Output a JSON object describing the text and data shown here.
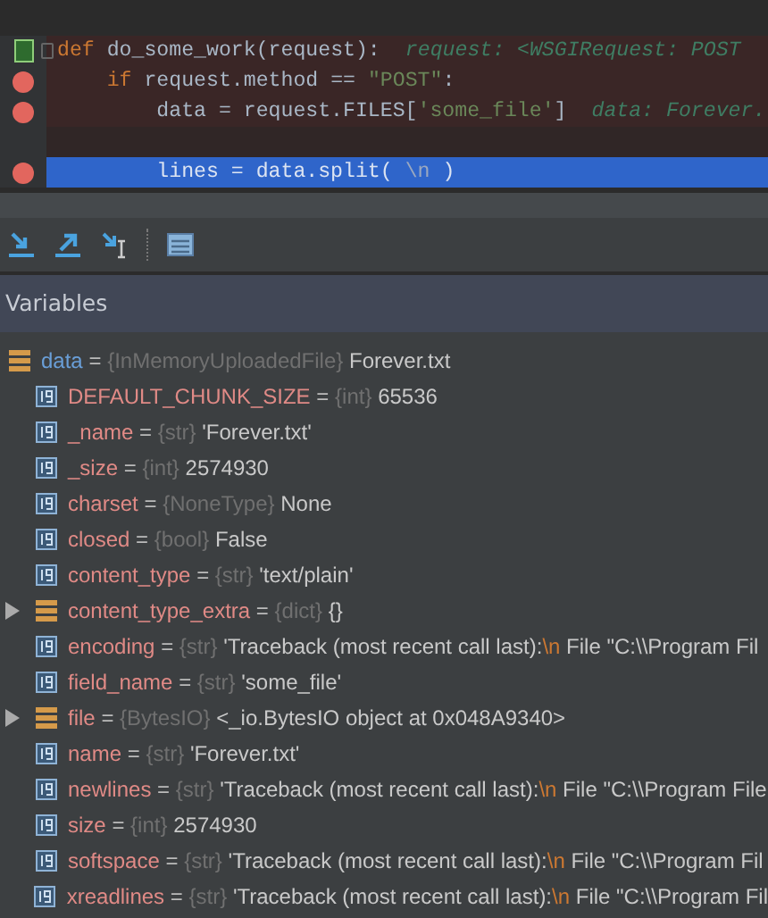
{
  "editor": {
    "lines": [
      {
        "breakpoint": false,
        "selected": false,
        "marker": true,
        "fold": true,
        "tokens": [
          {
            "kind": "keyword",
            "text": "def"
          },
          {
            "kind": "plain",
            "text": " do_some_work(request):"
          },
          {
            "kind": "hint",
            "text": "request: <WSGIRequest: POST"
          }
        ]
      },
      {
        "breakpoint": true,
        "selected": false,
        "marker": false,
        "fold": false,
        "tokens": [
          {
            "kind": "keyword",
            "text": "    if"
          },
          {
            "kind": "plain",
            "text": " request.method == "
          },
          {
            "kind": "string",
            "text": "\"POST\""
          },
          {
            "kind": "plain",
            "text": ":"
          }
        ]
      },
      {
        "breakpoint": true,
        "selected": false,
        "marker": false,
        "fold": false,
        "tokens": [
          {
            "kind": "plain",
            "text": "        data = request.FILES["
          },
          {
            "kind": "string",
            "text": "'some_file'"
          },
          {
            "kind": "plain",
            "text": "]"
          },
          {
            "kind": "hint",
            "text": "data: Forever."
          }
        ]
      },
      {
        "breakpoint": false,
        "selected": false,
        "marker": false,
        "fold": false
      },
      {
        "breakpoint": true,
        "selected": true,
        "marker": false,
        "fold": false,
        "tokens": [
          {
            "kind": "plain",
            "text": "        lines = data.split( "
          },
          {
            "kind": "string",
            "text": "\\n"
          },
          {
            "kind": "plain",
            "text": " )"
          }
        ]
      }
    ]
  },
  "toolbar": [
    {
      "kind": "step-into"
    },
    {
      "kind": "step-out"
    },
    {
      "kind": "step-into-my-code"
    },
    {
      "kind": "separator"
    },
    {
      "kind": "evaluate"
    }
  ],
  "panel_title": "Variables",
  "variables": [
    {
      "kind": "object",
      "expandable": false,
      "name": "data",
      "op": "=",
      "type": "{InMemoryUploadedFile}",
      "value": [
        {
          "kind": "plain",
          "text": "Forever.txt"
        }
      ],
      "children": [
        {
          "kind": "field",
          "expandable": false,
          "name": "DEFAULT_CHUNK_SIZE",
          "op": "=",
          "type": "{int}",
          "value": [
            {
              "kind": "plain",
              "text": "65536"
            }
          ]
        },
        {
          "kind": "field",
          "expandable": false,
          "name": "_name",
          "op": "=",
          "type": "{str}",
          "value": [
            {
              "kind": "plain",
              "text": "'Forever.txt'"
            }
          ]
        },
        {
          "kind": "field",
          "expandable": false,
          "name": "_size",
          "op": "=",
          "type": "{int}",
          "value": [
            {
              "kind": "plain",
              "text": "2574930"
            }
          ]
        },
        {
          "kind": "field",
          "expandable": false,
          "name": "charset",
          "op": "=",
          "type": "{NoneType}",
          "value": [
            {
              "kind": "plain",
              "text": "None"
            }
          ]
        },
        {
          "kind": "field",
          "expandable": false,
          "name": "closed",
          "op": "=",
          "type": "{bool}",
          "value": [
            {
              "kind": "plain",
              "text": "False"
            }
          ]
        },
        {
          "kind": "field",
          "expandable": false,
          "name": "content_type",
          "op": "=",
          "type": "{str}",
          "value": [
            {
              "kind": "plain",
              "text": "'text/plain'"
            }
          ]
        },
        {
          "kind": "object",
          "expandable": true,
          "name": "content_type_extra",
          "op": "=",
          "type": "{dict}",
          "value": [
            {
              "kind": "plain",
              "text": "{}"
            }
          ]
        },
        {
          "kind": "field",
          "expandable": false,
          "name": "encoding",
          "op": "=",
          "type": "{str}",
          "value": [
            {
              "kind": "plain",
              "text": "'Traceback (most recent call last):"
            },
            {
              "kind": "escape",
              "text": "\\n"
            },
            {
              "kind": "plain",
              "text": "  File \"C:\\\\Program Fil"
            }
          ]
        },
        {
          "kind": "field",
          "expandable": false,
          "name": "field_name",
          "op": "=",
          "type": "{str}",
          "value": [
            {
              "kind": "plain",
              "text": "'some_file'"
            }
          ]
        },
        {
          "kind": "object",
          "expandable": true,
          "name": "file",
          "op": "=",
          "type": "{BytesIO}",
          "value": [
            {
              "kind": "plain",
              "text": "<_io.BytesIO object at 0x048A9340>"
            }
          ]
        },
        {
          "kind": "field",
          "expandable": false,
          "name": "name",
          "op": "=",
          "type": "{str}",
          "value": [
            {
              "kind": "plain",
              "text": "'Forever.txt'"
            }
          ]
        },
        {
          "kind": "field",
          "expandable": false,
          "name": "newlines",
          "op": "=",
          "type": "{str}",
          "value": [
            {
              "kind": "plain",
              "text": "'Traceback (most recent call last):"
            },
            {
              "kind": "escape",
              "text": "\\n"
            },
            {
              "kind": "plain",
              "text": "  File \"C:\\\\Program File"
            }
          ]
        },
        {
          "kind": "field",
          "expandable": false,
          "name": "size",
          "op": "=",
          "type": "{int}",
          "value": [
            {
              "kind": "plain",
              "text": "2574930"
            }
          ]
        },
        {
          "kind": "field",
          "expandable": false,
          "name": "softspace",
          "op": "=",
          "type": "{str}",
          "value": [
            {
              "kind": "plain",
              "text": "'Traceback (most recent call last):"
            },
            {
              "kind": "escape",
              "text": "\\n"
            },
            {
              "kind": "plain",
              "text": "  File \"C:\\\\Program Fil"
            }
          ]
        },
        {
          "kind": "field",
          "expandable": false,
          "name": "xreadlines",
          "op": "=",
          "type": "{str}",
          "value": [
            {
              "kind": "plain",
              "text": "'Traceback (most recent call last):"
            },
            {
              "kind": "escape",
              "text": "\\n"
            },
            {
              "kind": "plain",
              "text": "  File \"C:\\\\Program Fil"
            }
          ]
        }
      ]
    }
  ]
}
